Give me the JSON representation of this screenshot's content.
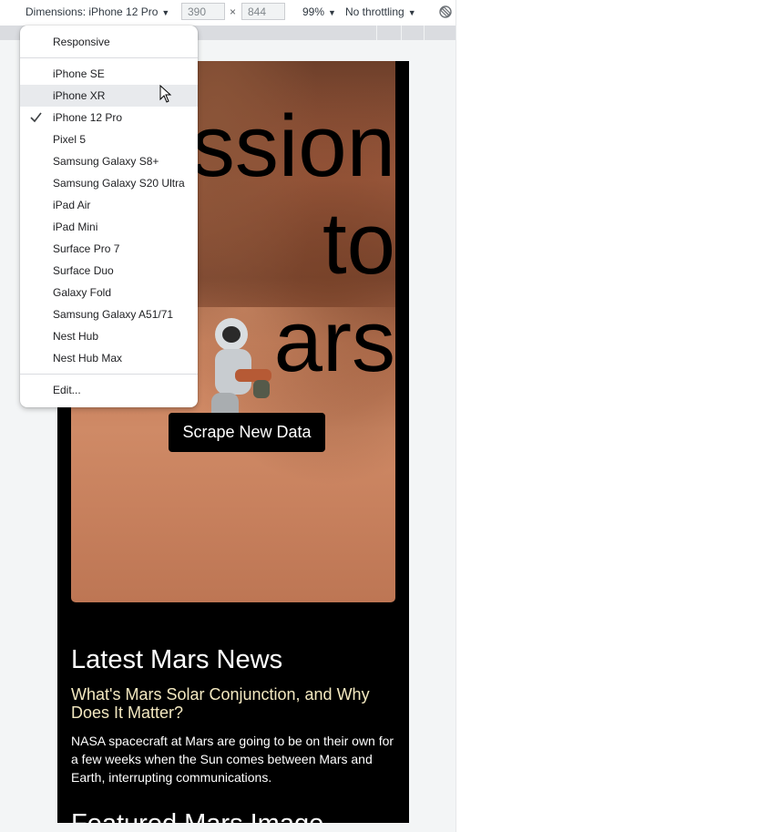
{
  "toolbar": {
    "dimensions_label": "Dimensions: iPhone 12 Pro",
    "width_value": "390",
    "times": "×",
    "height_value": "844",
    "zoom": "99%",
    "throttling": "No throttling"
  },
  "device_menu": {
    "top_item": "Responsive",
    "devices": [
      "iPhone SE",
      "iPhone XR",
      "iPhone 12 Pro",
      "Pixel 5",
      "Samsung Galaxy S8+",
      "Samsung Galaxy S20 Ultra",
      "iPad Air",
      "iPad Mini",
      "Surface Pro 7",
      "Surface Duo",
      "Galaxy Fold",
      "Samsung Galaxy A51/71",
      "Nest Hub",
      "Nest Hub Max"
    ],
    "selected": "iPhone 12 Pro",
    "hovered": "iPhone XR",
    "edit_item": "Edit..."
  },
  "page": {
    "hero_title_lines": [
      "ssion",
      "to",
      "ars"
    ],
    "scrape_button": "Scrape New Data",
    "news_heading": "Latest Mars News",
    "news_title": "What's Mars Solar Conjunction, and Why Does It Matter?",
    "news_body": "NASA spacecraft at Mars are going to be on their own for a few weeks when the Sun comes between Mars and Earth, interrupting communications.",
    "featured_heading": "Featured Mars Image"
  },
  "colors": {
    "page_bg": "#000000",
    "news_title": "#f3e8c0",
    "menu_hover": "#e8eaed"
  },
  "icons": {
    "rotate": "rotate-icon",
    "check": "check-icon",
    "cursor": "mouse-pointer-icon"
  }
}
